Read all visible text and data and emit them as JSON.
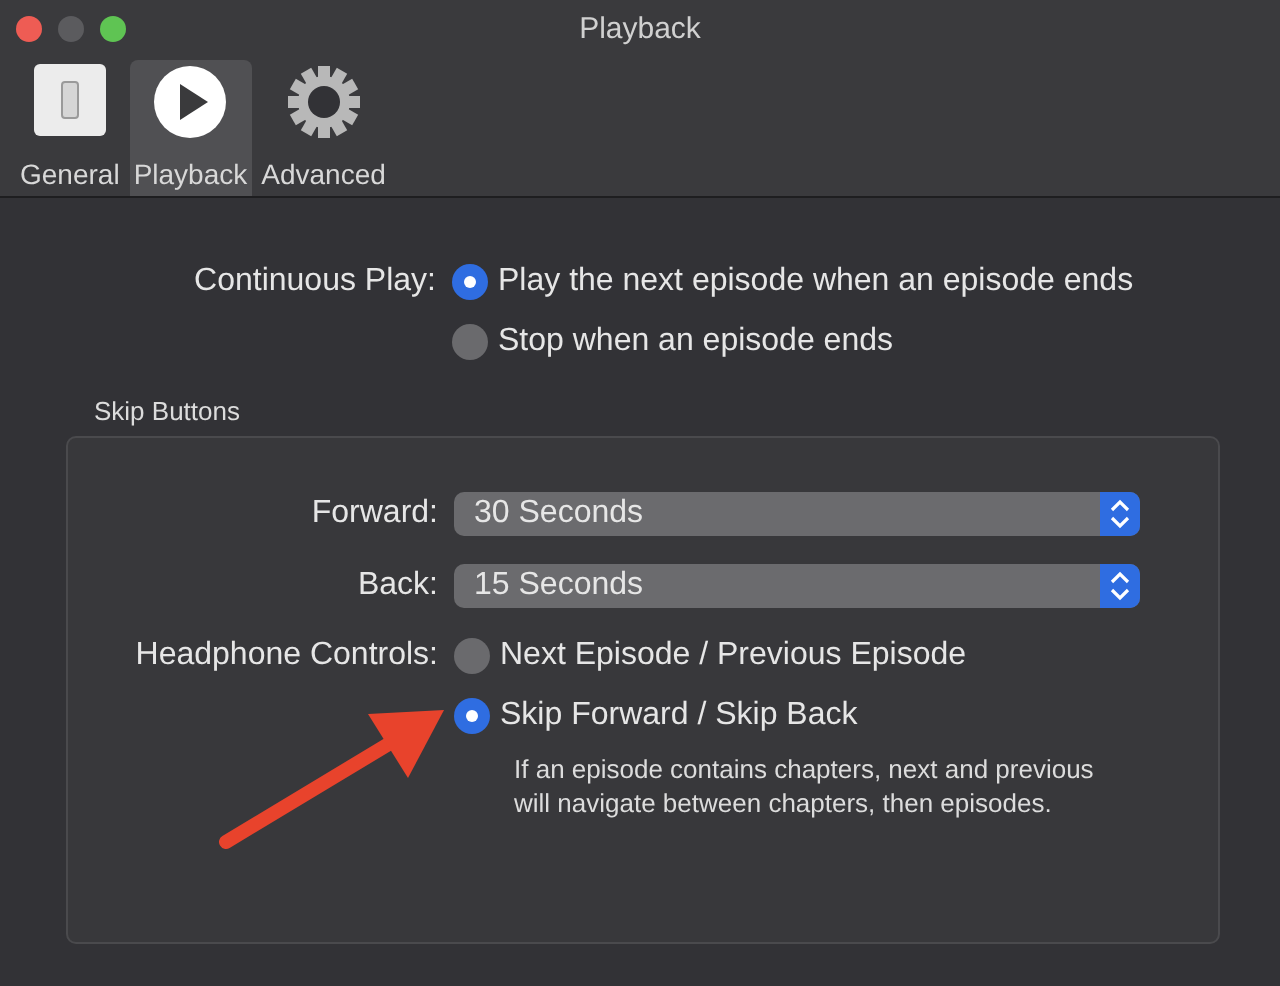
{
  "window": {
    "title": "Playback"
  },
  "tabs": [
    {
      "label": "General",
      "kind": "switch",
      "selected": false
    },
    {
      "label": "Playback",
      "kind": "play",
      "selected": true
    },
    {
      "label": "Advanced",
      "kind": "gear",
      "selected": false
    }
  ],
  "continuous_play": {
    "label": "Continuous Play:",
    "options": [
      {
        "label": "Play the next episode when an episode ends",
        "selected": true
      },
      {
        "label": "Stop when an episode ends",
        "selected": false
      }
    ]
  },
  "skip_buttons": {
    "title": "Skip Buttons",
    "popups": [
      {
        "label": "Forward:",
        "value": "30 Seconds"
      },
      {
        "label": "Back:",
        "value": "15 Seconds"
      }
    ],
    "headphone_controls": {
      "label": "Headphone Controls:",
      "options": [
        {
          "label": "Next Episode / Previous Episode",
          "selected": false
        },
        {
          "label": "Skip Forward / Skip Back",
          "selected": true
        }
      ],
      "note": "If an episode contains chapters, next and previous will navigate between chapters, then episodes."
    }
  }
}
